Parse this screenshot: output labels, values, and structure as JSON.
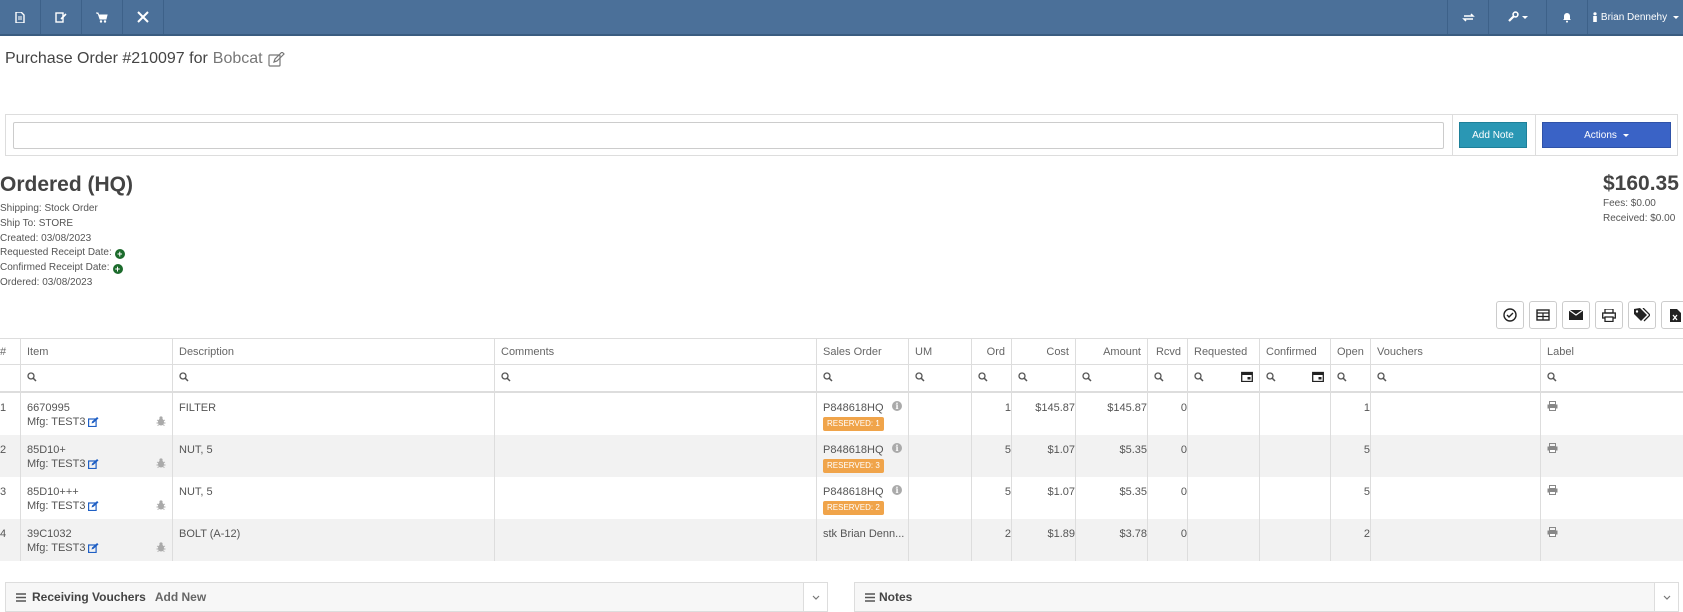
{
  "nav": {
    "left_icons": [
      "file-icon",
      "edit-doc-icon",
      "cart-icon",
      "tools-icon"
    ],
    "right_icons": [
      "exchange-icon",
      "wrench-icon",
      "bell-icon"
    ],
    "user_name": "Brian Dennehy"
  },
  "header": {
    "title_prefix": "Purchase Order #210097 for",
    "vendor": "Bobcat"
  },
  "note_bar": {
    "input_value": "",
    "add_note_label": "Add Note",
    "actions_label": "Actions"
  },
  "order": {
    "status": "Ordered (HQ)",
    "shipping": "Shipping: Stock Order",
    "ship_to": "Ship To: STORE",
    "created": "Created: 03/08/2023",
    "requested_receipt": "Requested Receipt Date:",
    "confirmed_receipt": "Confirmed Receipt Date:",
    "ordered": "Ordered: 03/08/2023"
  },
  "totals": {
    "amount": "$160.35",
    "fees": "Fees: $0.00",
    "received": "Received: $0.00"
  },
  "toolbar_icons": [
    "check-circle-icon",
    "table-icon",
    "envelope-icon",
    "print-icon",
    "tags-icon",
    "excel-icon"
  ],
  "grid": {
    "columns": [
      "#",
      "Item",
      "Description",
      "Comments",
      "Sales Order",
      "UM",
      "Ord",
      "Cost",
      "Amount",
      "Rcvd",
      "Requested",
      "Confirmed",
      "Open",
      "Vouchers",
      "Label"
    ],
    "rows": [
      {
        "num": "1",
        "item": "6670995",
        "mfg": "Mfg: TEST3",
        "description": "FILTER",
        "comments": "",
        "sales_order": "P848618HQ",
        "reserved": "RESERVED: 1",
        "um": "",
        "ord": "1",
        "cost": "$145.87",
        "amount": "$145.87",
        "rcvd": "0",
        "requested": "",
        "confirmed": "",
        "open": "1",
        "vouchers": ""
      },
      {
        "num": "2",
        "item": "85D10+",
        "mfg": "Mfg: TEST3",
        "description": "NUT, 5",
        "comments": "",
        "sales_order": "P848618HQ",
        "reserved": "RESERVED: 3",
        "um": "",
        "ord": "5",
        "cost": "$1.07",
        "amount": "$5.35",
        "rcvd": "0",
        "requested": "",
        "confirmed": "",
        "open": "5",
        "vouchers": ""
      },
      {
        "num": "3",
        "item": "85D10+++",
        "mfg": "Mfg: TEST3",
        "description": "NUT, 5",
        "comments": "",
        "sales_order": "P848618HQ",
        "reserved": "RESERVED: 2",
        "um": "",
        "ord": "5",
        "cost": "$1.07",
        "amount": "$5.35",
        "rcvd": "0",
        "requested": "",
        "confirmed": "",
        "open": "5",
        "vouchers": ""
      },
      {
        "num": "4",
        "item": "39C1032",
        "mfg": "Mfg: TEST3",
        "description": "BOLT (A-12)",
        "comments": "",
        "sales_order": "stk Brian Denn...",
        "reserved": "",
        "um": "",
        "ord": "2",
        "cost": "$1.89",
        "amount": "$3.78",
        "rcvd": "0",
        "requested": "",
        "confirmed": "",
        "open": "2",
        "vouchers": ""
      }
    ]
  },
  "panels": {
    "receiving_vouchers": "Receiving Vouchers",
    "add_new": "Add New",
    "notes": "Notes"
  },
  "colors": {
    "topbar": "#4b7099",
    "add_note": "#2a97b4",
    "actions": "#3a63c6",
    "reserved_badge": "#f0a44a",
    "plus_green": "#1c6b2c"
  }
}
